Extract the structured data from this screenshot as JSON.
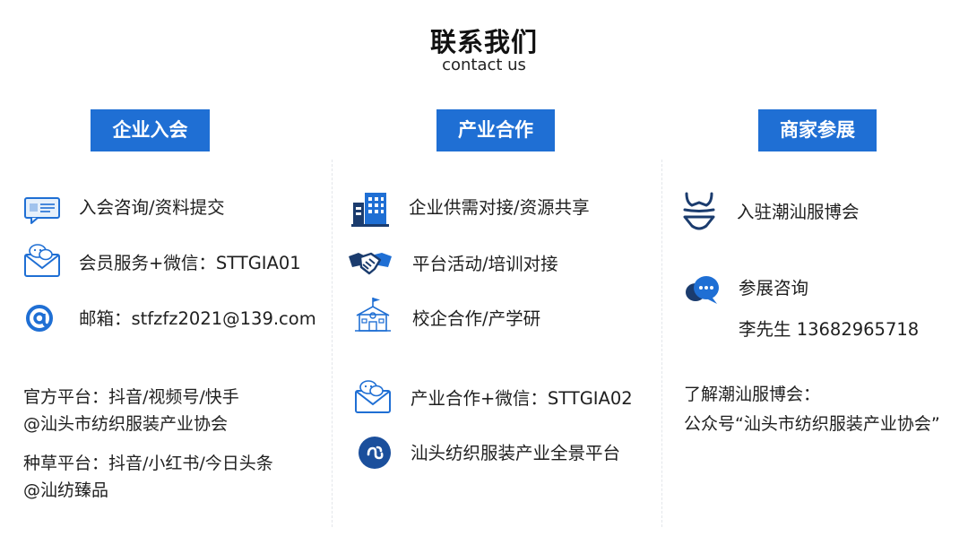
{
  "header": {
    "title": "联系我们",
    "subtitle": "contact us"
  },
  "colors": {
    "accent": "#1f6fd4",
    "icon_dark": "#1b3c6e",
    "icon_blue": "#1f6fd4"
  },
  "columns": [
    {
      "badge": "企业入会",
      "items": [
        {
          "icon": "message-card-icon",
          "text": "入会咨询/资料提交"
        },
        {
          "icon": "wechat-envelope-icon",
          "text": "会员服务+微信：STTGIA01"
        },
        {
          "icon": "at-sign-icon",
          "text": "邮箱：stfzfz2021@139.com"
        }
      ],
      "notes": [
        {
          "line1": "官方平台：抖音/视频号/快手",
          "line2": "@汕头市纺织服装产业协会"
        },
        {
          "line1": "种草平台：抖音/小红书/今日头条",
          "line2": "@汕纺臻品"
        }
      ]
    },
    {
      "badge": "产业合作",
      "items": [
        {
          "icon": "building-icon",
          "text": "企业供需对接/资源共享"
        },
        {
          "icon": "handshake-icon",
          "text": "平台活动/培训对接"
        },
        {
          "icon": "school-icon",
          "text": "校企合作/产学研"
        },
        {
          "icon": "wechat-envelope-icon",
          "text": "产业合作+微信：STTGIA02"
        },
        {
          "icon": "mini-program-icon",
          "text": "汕头纺织服装产业全景平台"
        }
      ]
    },
    {
      "badge": "商家参展",
      "items": [
        {
          "icon": "swimsuit-icon",
          "text": "入驻潮汕服博会"
        },
        {
          "icon": "chat-bubble-icon",
          "text": "参展咨询"
        }
      ],
      "contact": "李先生 13682965718",
      "notes": [
        {
          "line1": "了解潮汕服博会：",
          "line2": "公众号“汕头市纺织服装产业协会”"
        }
      ]
    }
  ]
}
